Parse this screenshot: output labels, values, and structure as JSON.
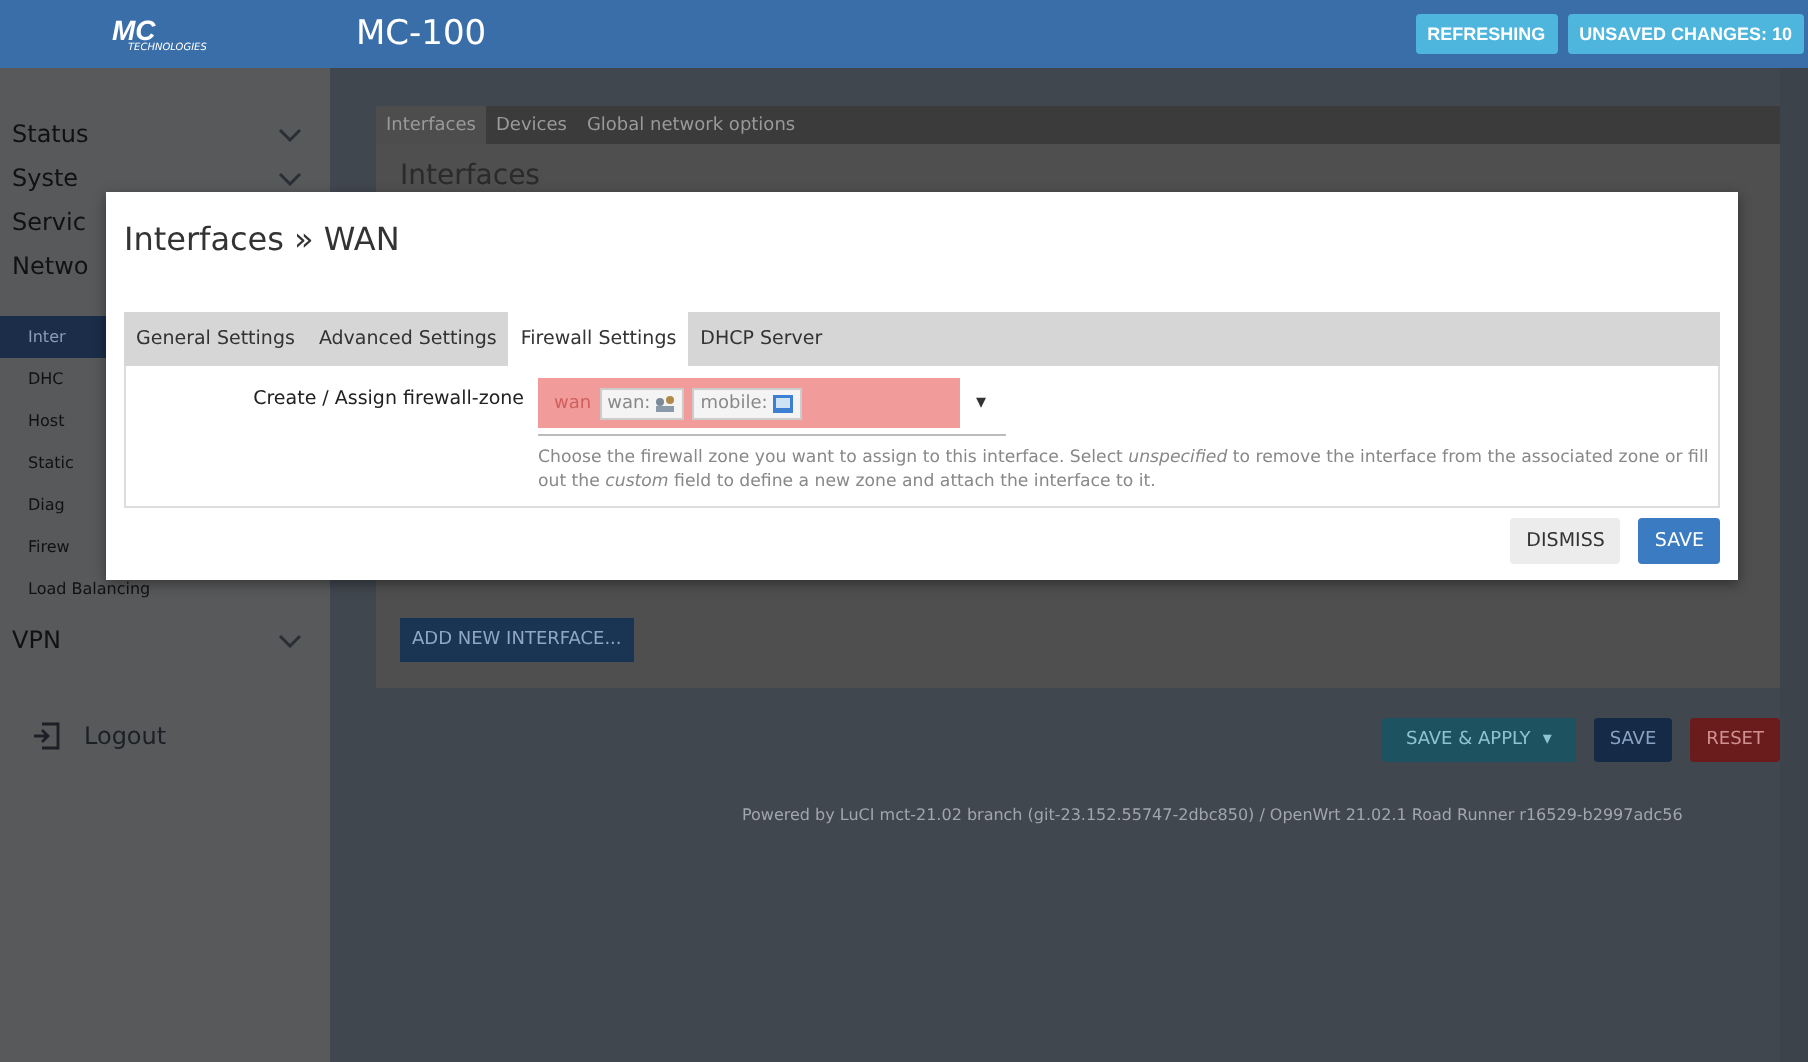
{
  "header": {
    "logo": {
      "mark": "MC",
      "sub": "TECHNOLOGIES"
    },
    "title": "MC-100",
    "badges": [
      "REFRESHING",
      "UNSAVED CHANGES: 10"
    ]
  },
  "sidebar": {
    "items": [
      {
        "label": "Status",
        "kind": "group",
        "chevron": true,
        "selected": false
      },
      {
        "label": "Syste",
        "kind": "group",
        "chevron": true,
        "selected": false
      },
      {
        "label": "Servic",
        "kind": "group",
        "chevron": false,
        "selected": false
      },
      {
        "label": "Netwo",
        "kind": "group",
        "chevron": false,
        "selected": false
      },
      {
        "label": "Inter",
        "kind": "sub",
        "chevron": false,
        "selected": true
      },
      {
        "label": "DHC",
        "kind": "sub",
        "chevron": false,
        "selected": false
      },
      {
        "label": "Host",
        "kind": "sub",
        "chevron": false,
        "selected": false
      },
      {
        "label": "Static",
        "kind": "sub",
        "chevron": false,
        "selected": false
      },
      {
        "label": "Diag",
        "kind": "sub",
        "chevron": false,
        "selected": false
      },
      {
        "label": "Firew",
        "kind": "sub",
        "chevron": false,
        "selected": false
      },
      {
        "label": "Load Balancing",
        "kind": "sub",
        "chevron": false,
        "selected": false
      },
      {
        "label": "VPN",
        "kind": "group",
        "chevron": true,
        "selected": false
      }
    ],
    "logout": "Logout"
  },
  "main": {
    "tabs": [
      {
        "label": "Interfaces",
        "selected": true
      },
      {
        "label": "Devices",
        "selected": false
      },
      {
        "label": "Global network options",
        "selected": false
      }
    ],
    "heading": "Interfaces",
    "add_button": "ADD NEW INTERFACE...",
    "actions": [
      {
        "label": "SAVE & APPLY",
        "kind": "apply"
      },
      {
        "label": "SAVE",
        "kind": "save"
      },
      {
        "label": "RESET",
        "kind": "reset"
      }
    ],
    "apply_caret": "▾",
    "footer": "Powered by LuCI mct-21.02 branch (git-23.152.55747-2dbc850) / OpenWrt 21.02.1 Road Runner r16529-b2997adc56"
  },
  "modal": {
    "title": "Interfaces » WAN",
    "tabs": [
      {
        "label": "General Settings",
        "selected": false
      },
      {
        "label": "Advanced Settings",
        "selected": false
      },
      {
        "label": "Firewall Settings",
        "selected": true
      },
      {
        "label": "DHCP Server",
        "selected": false
      }
    ],
    "field": {
      "label": "Create / Assign firewall-zone",
      "zones": [
        {
          "label": "wan",
          "kind": "name"
        },
        {
          "label": "wan:",
          "kind": "wan"
        },
        {
          "label": "mobile:",
          "kind": "mobile"
        }
      ],
      "caret": "▾"
    },
    "description": "Choose the firewall zone you want to assign to this interface. Select *unspecified* to remove the interface from the associated zone or fill out the *custom* field to define a new zone and attach the interface to it.",
    "buttons": [
      {
        "label": "DISMISS",
        "kind": "secondary"
      },
      {
        "label": "SAVE",
        "kind": "primary"
      }
    ]
  }
}
